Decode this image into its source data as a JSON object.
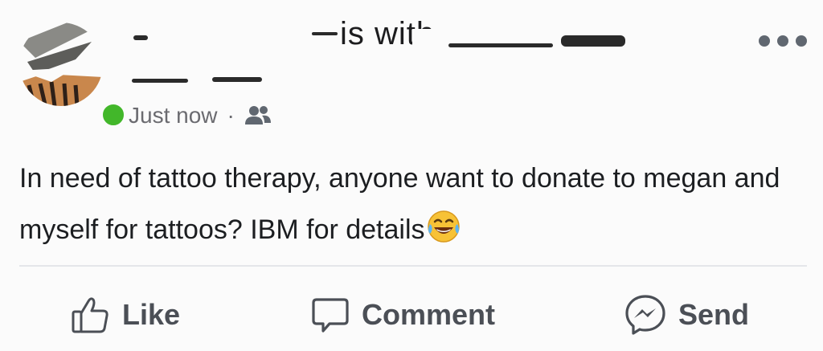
{
  "post": {
    "header_with_text": "is with",
    "timestamp": "Just now",
    "separator": "·",
    "audience_icon": "friends-icon",
    "more_icon": "more-horizontal-icon",
    "body_text": "In need of tattoo therapy, anyone want to donate to megan and myself for tattoos? IBM for details",
    "body_emoji": "laughing-tears-emoji"
  },
  "actions": {
    "like_label": "Like",
    "like_icon": "thumbs-up-icon",
    "comment_label": "Comment",
    "comment_icon": "speech-bubble-icon",
    "send_label": "Send",
    "send_icon": "messenger-icon"
  },
  "colors": {
    "online": "#42b72a",
    "text": "#1c1e21",
    "meta": "#6b6b70",
    "action": "#4b4f56"
  }
}
